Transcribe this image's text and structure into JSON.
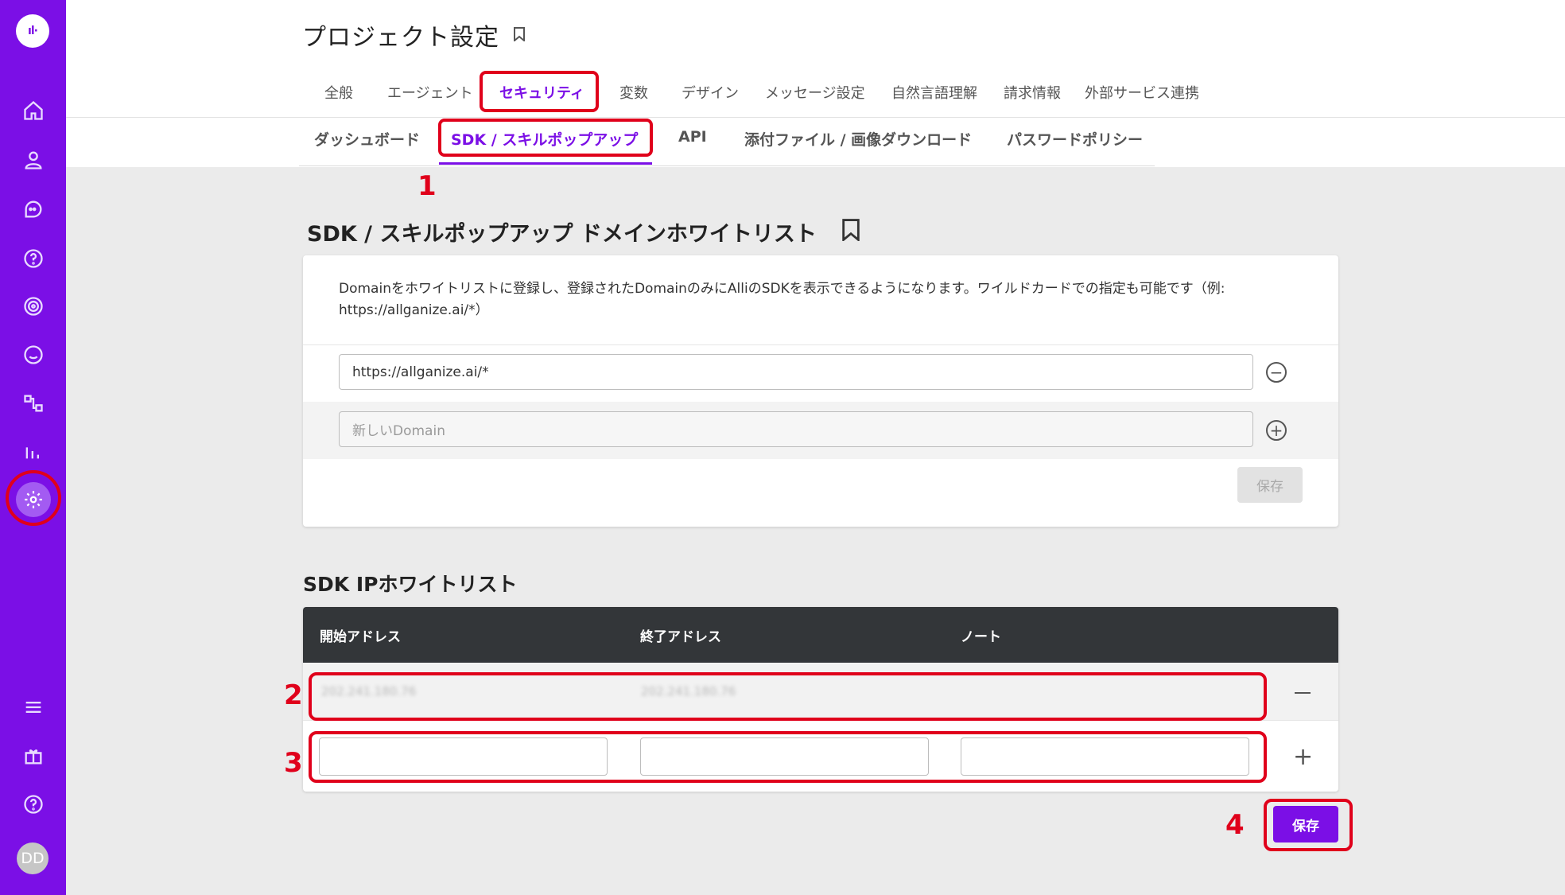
{
  "app": {
    "page_title": "プロジェクト設定"
  },
  "sidebar": {
    "items": [
      {
        "icon": "home-icon"
      },
      {
        "icon": "user-icon"
      },
      {
        "icon": "chat-icon"
      },
      {
        "icon": "faq-icon"
      },
      {
        "icon": "target-icon"
      },
      {
        "icon": "conversation-icon"
      },
      {
        "icon": "flow-icon"
      },
      {
        "icon": "analytics-icon"
      },
      {
        "icon": "gear-icon",
        "active": true
      },
      {
        "icon": "menu-icon"
      },
      {
        "icon": "gift-icon"
      },
      {
        "icon": "help-icon"
      }
    ],
    "avatar": "DD"
  },
  "tabs": [
    {
      "label": "全般"
    },
    {
      "label": "エージェント"
    },
    {
      "label": "セキュリティ",
      "active": true
    },
    {
      "label": "変数"
    },
    {
      "label": "デザイン"
    },
    {
      "label": "メッセージ設定"
    },
    {
      "label": "自然言語理解"
    },
    {
      "label": "請求情報"
    },
    {
      "label": "外部サービス連携"
    }
  ],
  "subtabs": [
    {
      "label": "ダッシュボード"
    },
    {
      "label": "SDK / スキルポップアップ",
      "active": true
    },
    {
      "label": "API"
    },
    {
      "label": "添付ファイル / 画像ダウンロード"
    },
    {
      "label": "パスワードポリシー"
    }
  ],
  "annotations": [
    "1",
    "2",
    "3",
    "4"
  ],
  "domain_whitelist": {
    "title": "SDK / スキルポップアップ ドメインホワイトリスト",
    "description": "Domainをホワイトリストに登録し、登録されたDomainのみにAlliのSDKを表示できるようになります。ワイルドカードでの指定も可能です（例: https://allganize.ai/*）",
    "domains": [
      "https://allganize.ai/*"
    ],
    "new_placeholder": "新しいDomain",
    "save_label": "保存"
  },
  "ip_whitelist": {
    "title": "SDK IPホワイトリスト",
    "columns": [
      "開始アドレス",
      "終了アドレス",
      "ノート"
    ],
    "rows": [
      {
        "start": "202.241.180.76",
        "end": "202.241.180.76",
        "note": ""
      }
    ],
    "save_label": "保存"
  },
  "colors": {
    "brand": "#7b0fe6",
    "annotation": "#e0001b",
    "table_header": "#333639"
  }
}
